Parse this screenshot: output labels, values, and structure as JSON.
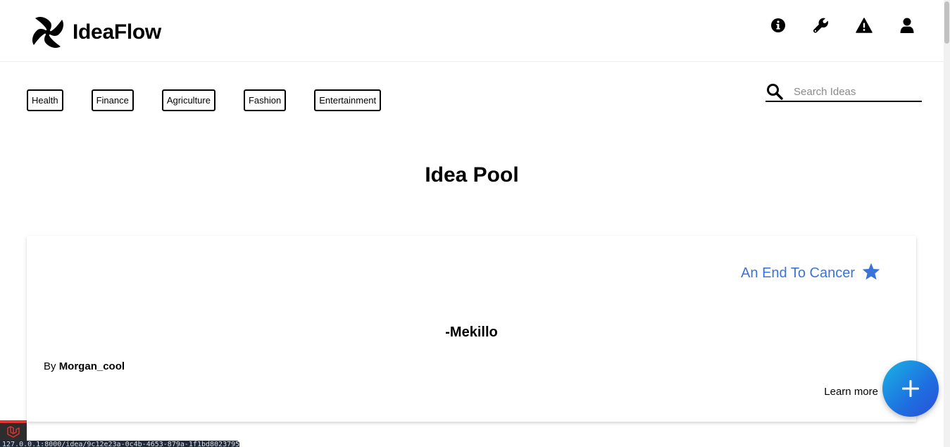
{
  "brand": {
    "name": "IdeaFlow"
  },
  "header": {
    "icons": [
      {
        "name": "info-icon"
      },
      {
        "name": "wrench-icon"
      },
      {
        "name": "warning-icon"
      },
      {
        "name": "user-icon"
      }
    ]
  },
  "categories": [
    "Health",
    "Finance",
    "Agriculture",
    "Fashion",
    "Entertainment"
  ],
  "search": {
    "placeholder": "Search Ideas",
    "value": ""
  },
  "page": {
    "title": "Idea Pool"
  },
  "card": {
    "title": "An End To Cancer",
    "quote": "-Mekillo",
    "by_prefix": "By",
    "author": "Morgan_cool",
    "learn_more": "Learn more"
  },
  "fab": {
    "icon": "plus-icon"
  },
  "statusbar": {
    "url": "127.0.0.1:8000/idea/9c12e23a-0c4b-4653-879a-1f1bd8023795"
  },
  "colors": {
    "accent": "#3a74d9",
    "fab_start": "#1bb3e4",
    "fab_end": "#2b4fd6",
    "laravel_red": "#e3342f"
  }
}
